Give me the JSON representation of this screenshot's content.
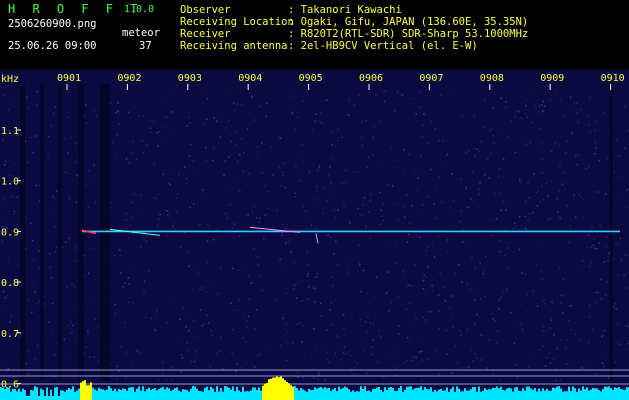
{
  "header": {
    "app_name": "H R O F F T",
    "version": "1.0.0",
    "filename": "2506260900.png",
    "datetime": "25.06.26 09:00",
    "meteor_label": "meteor",
    "meteor_count": "37",
    "info": [
      {
        "label": "Observer",
        "value": ": Takanori Kawachi"
      },
      {
        "label": "Receiving Location",
        "value": ": Ogaki, Gifu, JAPAN (136.60E, 35.35N)"
      },
      {
        "label": "Receiver",
        "value": ": R820T2(RTL-SDR) SDR-Sharp 53.1000MHz"
      },
      {
        "label": "Receiving antenna",
        "value": ": 2el-HB9CV Vertical (el. E-W)"
      }
    ]
  },
  "spectrogram": {
    "y_unit": "kHz",
    "y_labels": [
      "1.1",
      "1.0",
      "0.9",
      "0.8",
      "0.7",
      "0.6"
    ],
    "y_values": [
      1.1,
      1.0,
      0.9,
      0.8,
      0.7,
      0.6
    ],
    "x_labels": [
      "0901",
      "0902",
      "0903",
      "0904",
      "0905",
      "0906",
      "0907",
      "0908",
      "0909",
      "0910"
    ],
    "x_values_min": [
      1,
      2,
      3,
      4,
      5,
      6,
      7,
      8,
      9,
      10
    ],
    "carrier_khz": 0.9,
    "colors": {
      "text_labels": "#ffff40",
      "text_info": "#ffffff",
      "text_title": "#3cff3c",
      "carrier": "#33ccff",
      "bars_main": "#00e5ff",
      "bars_meteor": "#ffff00",
      "background": "#0a0a40"
    }
  }
}
